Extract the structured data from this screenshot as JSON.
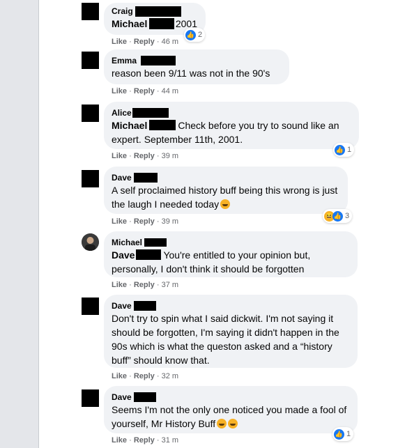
{
  "actions": {
    "like": "Like",
    "reply": "Reply",
    "sep": "·"
  },
  "comments": [
    {
      "author": "Craig",
      "tag": "Michael",
      "text": "2001",
      "time": "46 m",
      "reactions": "2"
    },
    {
      "author": "Emma",
      "text": "reason been 9/11 was not in the 90's",
      "time": "44 m"
    },
    {
      "author": "Alice",
      "tag": "Michael",
      "text": "Check before you try to sound like an expert. September 11th, 2001.",
      "time": "39 m",
      "reactions": "1"
    },
    {
      "author": "Dave",
      "text": "A self proclaimed history buff being this wrong is just the laugh I needed today",
      "time": "39 m",
      "reactions": "3"
    },
    {
      "author": "Michael",
      "tag": "Dave",
      "text": "You're entitled to your opinion but, personally, I don't think it should be forgotten",
      "time": "37 m"
    },
    {
      "author": "Dave",
      "text": "Don't try to spin what I said dickwit. I'm not saying it should be forgotten, I'm saying it didn't happen in the 90s which is what the queston asked and a “history buff” should know that.",
      "time": "32 m"
    },
    {
      "author": "Dave",
      "text": "Seems I'm not the only one noticed you made a fool of yourself, Mr History Buff",
      "time": "31 m",
      "reactions": "1"
    }
  ]
}
